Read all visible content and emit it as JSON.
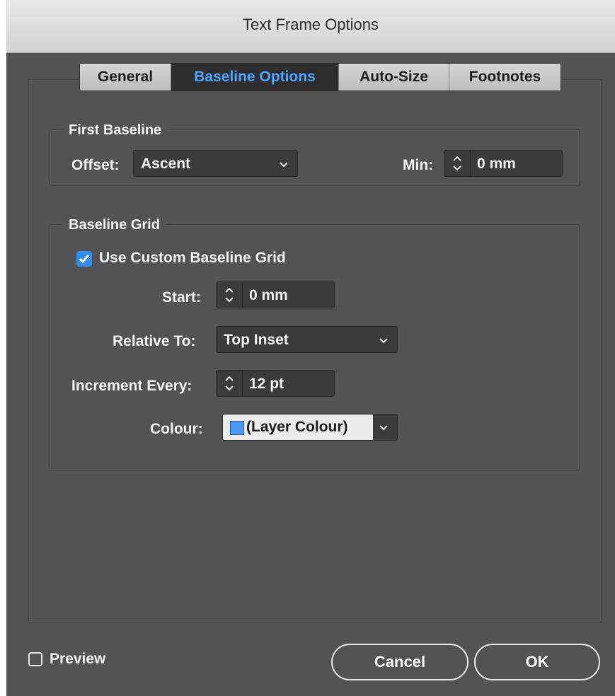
{
  "window": {
    "title": "Text Frame Options"
  },
  "tabs": [
    {
      "label": "General",
      "active": false
    },
    {
      "label": "Baseline Options",
      "active": true
    },
    {
      "label": "Auto-Size",
      "active": false
    },
    {
      "label": "Footnotes",
      "active": false
    }
  ],
  "first_baseline": {
    "group_label": "First Baseline",
    "offset_label": "Offset:",
    "offset_value": "Ascent",
    "min_label": "Min:",
    "min_value": "0 mm"
  },
  "baseline_grid": {
    "group_label": "Baseline Grid",
    "use_custom_label": "Use Custom Baseline Grid",
    "use_custom_checked": true,
    "start_label": "Start:",
    "start_value": "0 mm",
    "relative_label": "Relative To:",
    "relative_value": "Top Inset",
    "increment_label": "Increment Every:",
    "increment_value": "12 pt",
    "colour_label": "Colour:",
    "colour_value": "(Layer Colour)",
    "colour_swatch": "#4a98f7"
  },
  "footer": {
    "preview_label": "Preview",
    "preview_checked": false,
    "cancel_label": "Cancel",
    "ok_label": "OK"
  },
  "colors": {
    "dialog_bg": "#535353",
    "accent": "#2f8cf3",
    "active_tab_text": "#4da3ff"
  }
}
